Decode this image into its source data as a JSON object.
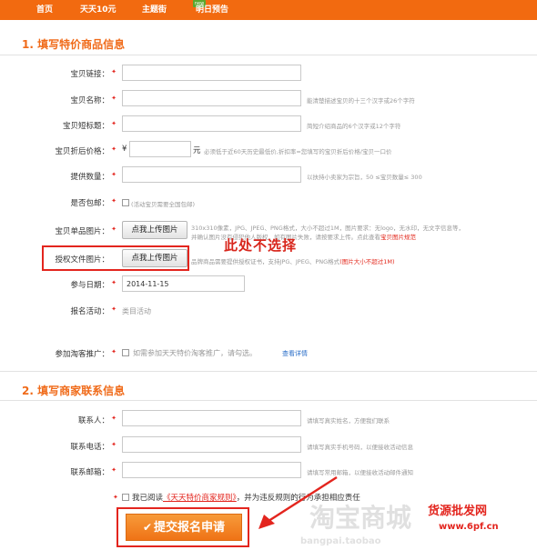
{
  "nav": {
    "items": [
      "首页",
      "天天10元",
      "主题街",
      "明日预告"
    ],
    "badge": "new"
  },
  "section1": {
    "title": "1. 填写特价商品信息",
    "fields": {
      "link": "宝贝链接：",
      "name": "宝贝名称：",
      "short_title": "宝贝短标题：",
      "price": "宝贝折后价格：",
      "quantity": "提供数量：",
      "shipping": "是否包邮：",
      "image": "宝贝单品图片：",
      "auth": "授权文件图片：",
      "date": "参与日期：",
      "activity": "报名活动：",
      "promo": "参加淘客推广："
    },
    "hints": {
      "name": "能清楚描述宝贝的十三个汉字或26个字符",
      "short_title": "简短介绍商品的6个汉字或12个字符",
      "price": "必须低于近60天历史最低价,折扣率=您填写的宝贝折后价格/宝贝一口价",
      "quantity": "以扶持小卖家为宗旨，50 ≤宝贝数量≤ 300",
      "shipping": "(活动宝贝需要全国包邮)",
      "image_line1": "310x310像素，JPG、JPEG、PNG格式，大小不超过1M，图片要求：无logo，无水印，无文字信息等，",
      "image_line2": "并确认图片没有侵犯他人版权，如有图片失败，请按要求上传。点此查看",
      "image_link": "宝贝图片规范",
      "auth_hint": "品牌商品需要提供授权证书，支持JPG、JPEG、PNG格式",
      "auth_red": "(图片大小不超过1M)",
      "promo_text": "如需参加天天特价淘客推广，请勾选。",
      "promo_link": "查看详情"
    },
    "currency": "¥",
    "currency_unit": "元",
    "upload_label": "点我上传图片",
    "date_value": "2014-11-15",
    "activity_value": "类目活动"
  },
  "annotation": "此处不选择",
  "section2": {
    "title": "2. 填写商家联系信息",
    "fields": {
      "contact": "联系人：",
      "phone": "联系电话：",
      "email": "联系邮箱："
    },
    "hints": {
      "contact": "请填写真实姓名，方便我们联系",
      "phone": "请填写真实手机号码，以便接收活动信息",
      "email": "请填写常用邮箱，以便接收活动邮件通知"
    },
    "agree_prefix": "我已阅读",
    "agree_link": "《天天特价商家规则》",
    "agree_suffix": "，并为违反规则的行为承担相应责任"
  },
  "submit_label": "提交报名申请",
  "watermark": {
    "brand": "淘宝商城",
    "site_cn": "货源批发网",
    "site_url": "www.6pf.cn",
    "bottom": "bangpai.taobao"
  },
  "colors": {
    "accent": "#f26a10",
    "section_title": "#f06b1a",
    "annotation": "#e3251e",
    "submit": "#ef7316"
  }
}
